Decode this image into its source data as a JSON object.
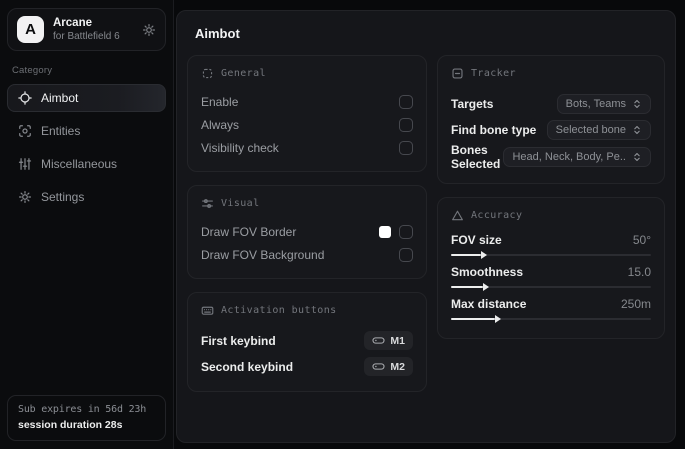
{
  "app": {
    "logo_letter": "A",
    "name": "Arcane",
    "subtitle": "for Battlefield 6"
  },
  "sidebar": {
    "category_label": "Category",
    "items": [
      {
        "label": "Aimbot"
      },
      {
        "label": "Entities"
      },
      {
        "label": "Miscellaneous"
      },
      {
        "label": "Settings"
      }
    ],
    "session": {
      "expiry": "Sub expires in 56d 23h",
      "duration": "session duration 28s"
    }
  },
  "main": {
    "title": "Aimbot",
    "general": {
      "title": "General",
      "rows": [
        {
          "label": "Enable",
          "checked": false
        },
        {
          "label": "Always",
          "checked": false
        },
        {
          "label": "Visibility check",
          "checked": false
        }
      ]
    },
    "visual": {
      "title": "Visual",
      "rows": [
        {
          "label": "Draw FOV Border",
          "swatch": "#ffffff",
          "checked": false
        },
        {
          "label": "Draw FOV Background",
          "checked": false
        }
      ]
    },
    "activation": {
      "title": "Activation buttons",
      "rows": [
        {
          "label": "First keybind",
          "key": "M1"
        },
        {
          "label": "Second keybind",
          "key": "M2"
        }
      ]
    },
    "tracker": {
      "title": "Tracker",
      "rows": [
        {
          "label": "Targets",
          "value": "Bots, Teams"
        },
        {
          "label": "Find bone type",
          "value": "Selected bone"
        },
        {
          "label": "Bones Selected",
          "value": "Head, Neck, Body, Pe.."
        }
      ]
    },
    "accuracy": {
      "title": "Accuracy",
      "rows": [
        {
          "label": "FOV size",
          "value": "50°",
          "percent": 15
        },
        {
          "label": "Smoothness",
          "value": "15.0",
          "percent": 16
        },
        {
          "label": "Max distance",
          "value": "250m",
          "percent": 22
        }
      ]
    }
  },
  "colors": {
    "accent": "#ffffff",
    "panel": "#15161a",
    "card": "#17181c"
  }
}
